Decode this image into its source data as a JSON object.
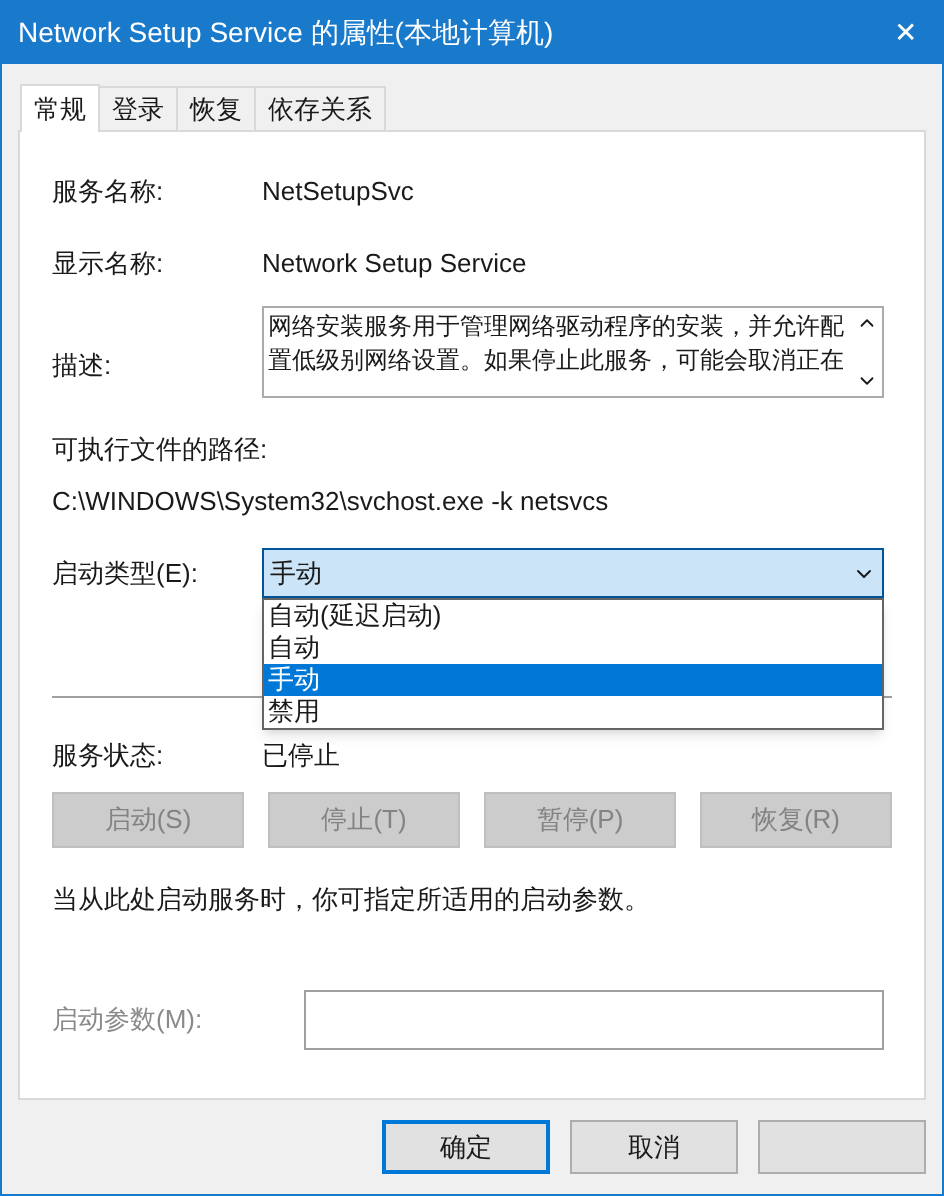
{
  "window": {
    "title": "Network Setup Service 的属性(本地计算机)",
    "close": "✕"
  },
  "tabs": [
    {
      "label": "常规",
      "selected": true
    },
    {
      "label": "登录",
      "selected": false
    },
    {
      "label": "恢复",
      "selected": false
    },
    {
      "label": "依存关系",
      "selected": false
    }
  ],
  "fields": [
    {
      "label": "服务名称:",
      "value": "NetSetupSvc"
    },
    {
      "label": "显示名称:",
      "value": "Network Setup Service"
    }
  ],
  "description": {
    "label": "描述:",
    "value": "网络安装服务用于管理网络驱动程序的安装，并允许配置低级别网络设置。如果停止此服务，可能会取消正在"
  },
  "executable": {
    "label": "可执行文件的路径:",
    "value": "C:\\WINDOWS\\System32\\svchost.exe -k netsvcs"
  },
  "startup_type": {
    "label": "启动类型(E):",
    "value": "手动",
    "expanded": true,
    "options": [
      {
        "label": "自动(延迟启动)",
        "selected": false
      },
      {
        "label": "自动",
        "selected": false
      },
      {
        "label": "手动",
        "selected": true
      },
      {
        "label": "禁用",
        "selected": false
      }
    ]
  },
  "service_status": {
    "label": "服务状态:",
    "value": "已停止"
  },
  "service_buttons": [
    {
      "label": "启动(S)",
      "disabled": true
    },
    {
      "label": "停止(T)",
      "disabled": true
    },
    {
      "label": "暂停(P)",
      "disabled": true
    },
    {
      "label": "恢复(R)",
      "disabled": true
    }
  ],
  "hint": "当从此处启动服务时，你可指定所适用的启动参数。",
  "start_parameters": {
    "label": "启动参数(M):",
    "disabled": true
  },
  "dialog_buttons": [
    {
      "label": "确定",
      "default": true
    },
    {
      "label": "取消",
      "default": false
    }
  ]
}
